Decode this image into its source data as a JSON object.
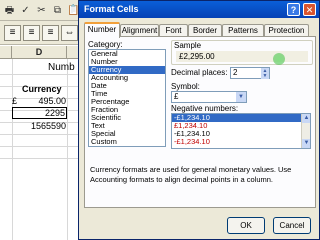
{
  "excel": {
    "column_header": "D",
    "numbers_heading": "Numb",
    "currency_heading": "Currency",
    "currency_symbol": "£",
    "rows": [
      {
        "value": "495.00"
      },
      {
        "value": "2295"
      },
      {
        "value": "1565590"
      }
    ]
  },
  "dialog": {
    "title": "Format Cells",
    "help_symbol": "?",
    "close_symbol": "✕",
    "tabs": [
      "Number",
      "Alignment",
      "Font",
      "Border",
      "Patterns",
      "Protection"
    ],
    "active_tab": "Number",
    "category_label": "Category:",
    "categories": [
      "General",
      "Number",
      "Currency",
      "Accounting",
      "Date",
      "Time",
      "Percentage",
      "Fraction",
      "Scientific",
      "Text",
      "Special",
      "Custom"
    ],
    "selected_category": "Currency",
    "sample_label": "Sample",
    "sample_value": "£2,295.00",
    "decimal_places_label": "Decimal places:",
    "decimal_places_value": "2",
    "symbol_label": "Symbol:",
    "symbol_value": "£",
    "negative_numbers_label": "Negative numbers:",
    "negative_numbers": [
      {
        "text": "-£1,234.10",
        "red": false,
        "selected": true
      },
      {
        "text": "£1,234.10",
        "red": true,
        "selected": false
      },
      {
        "text": "-£1,234.10",
        "red": false,
        "selected": false
      },
      {
        "text": "-£1,234.10",
        "red": true,
        "selected": false
      }
    ],
    "description": "Currency formats are used for general monetary values.  Use Accounting formats to align decimal points in a column.",
    "ok_label": "OK",
    "cancel_label": "Cancel"
  },
  "colors": {
    "title_bar": "#0a5fd8",
    "selection": "#316ac5",
    "negative_red": "#c00000",
    "tab_highlight": "#f2a03a"
  }
}
